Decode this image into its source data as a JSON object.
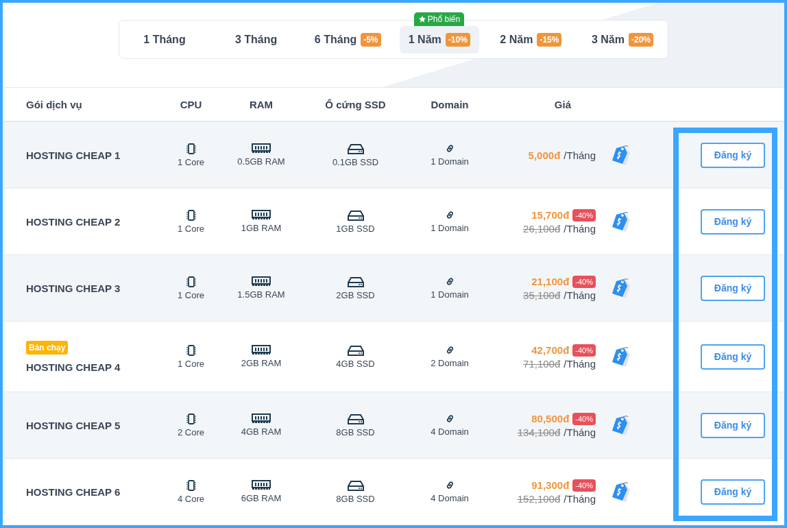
{
  "tabs": [
    {
      "label": "1 Tháng",
      "selected": false
    },
    {
      "label": "3 Tháng",
      "selected": false
    },
    {
      "label": "6 Tháng",
      "discount": "-5%",
      "selected": false
    },
    {
      "label": "1 Năm",
      "discount": "-10%",
      "badge": "Phổ biến",
      "selected": true
    },
    {
      "label": "2 Năm",
      "discount": "-15%",
      "selected": false
    },
    {
      "label": "3 Năm",
      "discount": "-20%",
      "selected": false
    }
  ],
  "table": {
    "columns": [
      "Gói dịch vụ",
      "CPU",
      "RAM",
      "Ổ cứng SSD",
      "Domain",
      "Giá"
    ],
    "rows": [
      {
        "name": "HOSTING CHEAP 1",
        "cpu": "1 Core",
        "ram": "0.5GB RAM",
        "ssd": "0.1GB SSD",
        "domain": "1 Domain",
        "price": "5,000đ",
        "unit": "/Tháng",
        "button": "Đăng ký"
      },
      {
        "name": "HOSTING CHEAP 2",
        "cpu": "1 Core",
        "ram": "1GB RAM",
        "ssd": "1GB SSD",
        "domain": "1 Domain",
        "price": "15,700đ",
        "discount": "-40%",
        "old_price": "26,100đ",
        "unit": "/Tháng",
        "button": "Đăng ký"
      },
      {
        "name": "HOSTING CHEAP 3",
        "cpu": "1 Core",
        "ram": "1.5GB RAM",
        "ssd": "2GB SSD",
        "domain": "1 Domain",
        "price": "21,100đ",
        "discount": "-40%",
        "old_price": "35,100đ",
        "unit": "/Tháng",
        "button": "Đăng ký"
      },
      {
        "name": "HOSTING CHEAP 4",
        "badge": "Bán chạy",
        "cpu": "1 Core",
        "ram": "2GB RAM",
        "ssd": "4GB SSD",
        "domain": "2 Domain",
        "price": "42,700đ",
        "discount": "-40%",
        "old_price": "71,100đ",
        "unit": "/Tháng",
        "button": "Đăng ký"
      },
      {
        "name": "HOSTING CHEAP 5",
        "cpu": "2 Core",
        "ram": "4GB RAM",
        "ssd": "8GB SSD",
        "domain": "4 Domain",
        "price": "80,500đ",
        "discount": "-40%",
        "old_price": "134,100đ",
        "unit": "/Tháng",
        "button": "Đăng ký"
      },
      {
        "name": "HOSTING CHEAP 6",
        "cpu": "4 Core",
        "ram": "6GB RAM",
        "ssd": "8GB SSD",
        "domain": "4 Domain",
        "price": "91,300đ",
        "discount": "-40%",
        "old_price": "152,100đ",
        "unit": "/Tháng",
        "button": "Đăng ký"
      }
    ]
  }
}
